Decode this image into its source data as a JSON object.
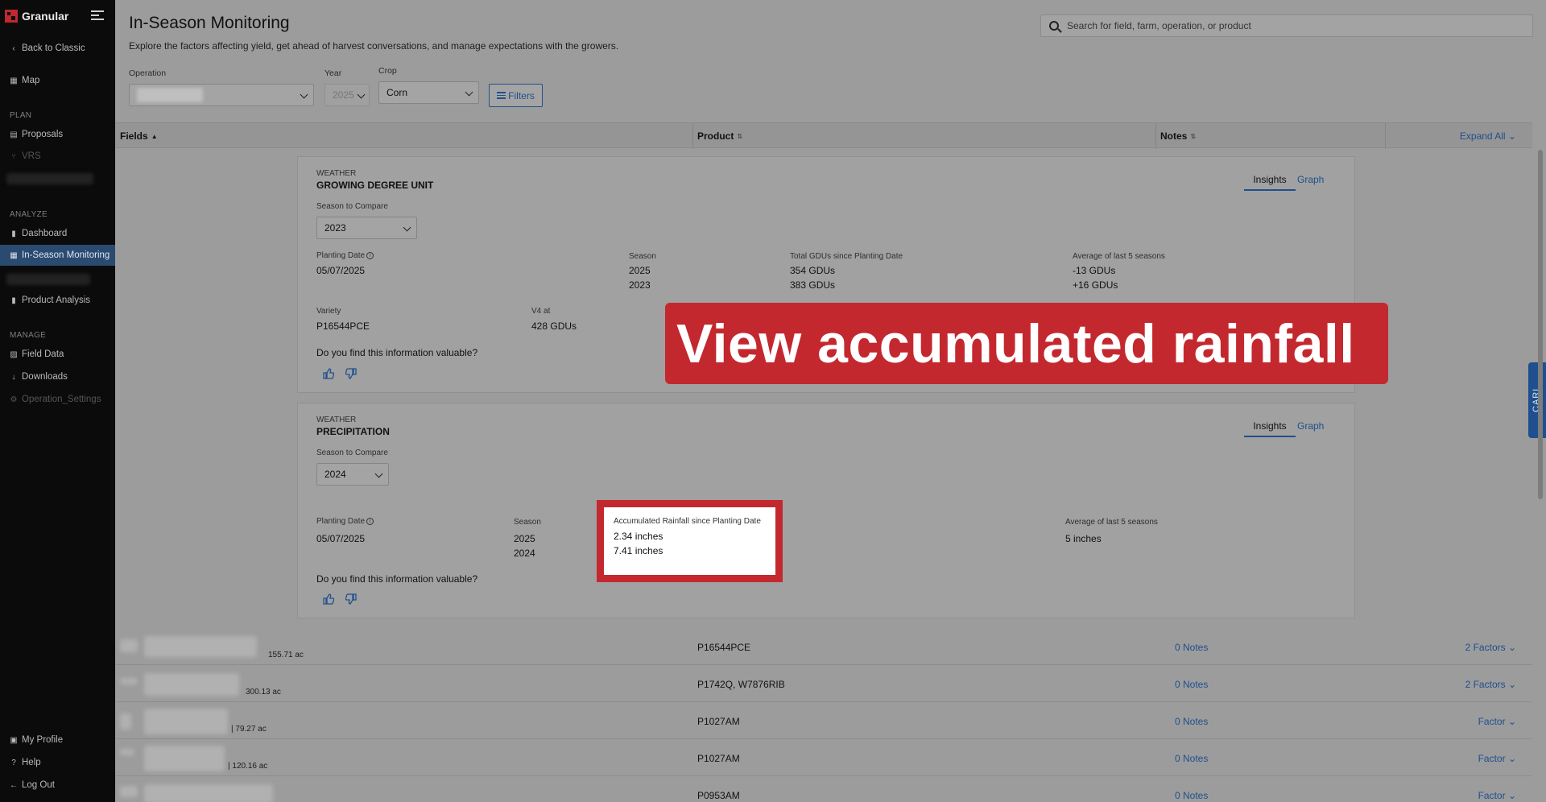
{
  "sidebar": {
    "brand": "Granular",
    "back": "Back to Classic",
    "map": "Map",
    "plan_section": "PLAN",
    "proposals": "Proposals",
    "vrs": "VRS",
    "analyze_section": "ANALYZE",
    "dashboard": "Dashboard",
    "in_season": "In-Season Monitoring",
    "product_analysis": "Product Analysis",
    "manage_section": "MANAGE",
    "field_data": "Field Data",
    "downloads": "Downloads",
    "operation_settings": "Operation_Settings",
    "my_profile": "My Profile",
    "help": "Help",
    "logout": "Log Out"
  },
  "header": {
    "title": "In-Season Monitoring",
    "subtitle": "Explore the factors affecting yield, get ahead of harvest conversations, and manage expectations with the growers.",
    "search_placeholder": "Search for field, farm, operation, or product"
  },
  "filters": {
    "operation_label": "Operation",
    "year_label": "Year",
    "year_value": "2025",
    "crop_label": "Crop",
    "crop_value": "Corn",
    "filters_button": "Filters"
  },
  "table": {
    "col_fields": "Fields",
    "col_product": "Product",
    "col_notes": "Notes",
    "expand_all": "Expand All"
  },
  "gdu_card": {
    "category": "WEATHER",
    "title": "GROWING DEGREE UNIT",
    "tab_insights": "Insights",
    "tab_graph": "Graph",
    "season_compare_label": "Season to Compare",
    "season_compare_value": "2023",
    "planting_date_label": "Planting Date",
    "planting_date": "05/07/2025",
    "season_label": "Season",
    "season_1": "2025",
    "season_2": "2023",
    "total_label": "Total GDUs since Planting Date",
    "total_1": "354 GDUs",
    "total_2": "383 GDUs",
    "avg_label": "Average of last 5 seasons",
    "avg_1": "-13 GDUs",
    "avg_2": "+16 GDUs",
    "variety_label": "Variety",
    "variety": "P16544PCE",
    "v4_label": "V4 at",
    "v4": "428 GDUs",
    "feedback": "Do you find this information valuable?"
  },
  "precip_card": {
    "category": "WEATHER",
    "title": "PRECIPITATION",
    "tab_insights": "Insights",
    "tab_graph": "Graph",
    "season_compare_label": "Season to Compare",
    "season_compare_value": "2024",
    "planting_date_label": "Planting Date",
    "planting_date": "05/07/2025",
    "season_label": "Season",
    "season_1": "2025",
    "season_2": "2024",
    "rain_label": "Accumulated Rainfall since Planting Date",
    "rain_1": "2.34 inches",
    "rain_2": "7.41 inches",
    "avg_label": "Average of last 5 seasons",
    "avg": "5 inches",
    "feedback": "Do you find this information valuable?"
  },
  "rows": [
    {
      "acres": "155.71 ac",
      "product": "P16544PCE",
      "notes": "0 Notes",
      "factors": "2 Factors"
    },
    {
      "acres": "300.13 ac",
      "product": "P1742Q, W7876RIB",
      "notes": "0 Notes",
      "factors": "2 Factors"
    },
    {
      "acres": "| 79.27 ac",
      "product": "P1027AM",
      "notes": "0 Notes",
      "factors": "Factor"
    },
    {
      "acres": "| 120.16 ac",
      "product": "P1027AM",
      "notes": "0 Notes",
      "factors": "Factor"
    },
    {
      "acres": "",
      "product": "P0953AM",
      "notes": "0 Notes",
      "factors": "Factor"
    }
  ],
  "banner": "View accumulated rainfall",
  "carl": "CARL",
  "colors": {
    "accent": "#1f4f8e",
    "highlight": "#c4282f",
    "sidebar": "#0b0b0c"
  }
}
